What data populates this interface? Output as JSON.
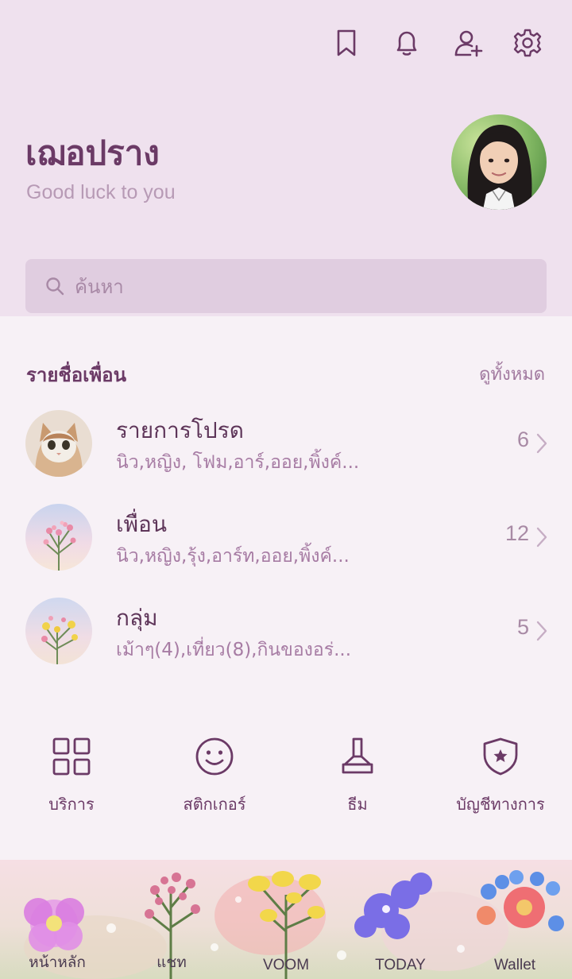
{
  "header": {
    "icons": [
      "bookmark-icon",
      "bell-icon",
      "add-friend-icon",
      "gear-icon"
    ]
  },
  "profile": {
    "name": "เฌอปราง",
    "status": "Good luck to you"
  },
  "search": {
    "placeholder": "ค้นหา"
  },
  "friends_section": {
    "title": "รายชื่อเพื่อน",
    "view_all": "ดูทั้งหมด",
    "rows": [
      {
        "title": "รายการโปรด",
        "subtitle": "นิว,หญิง, โฟม,อาร์,ออย,พิ้งค์...",
        "count": "6",
        "thumb": "cat-photo"
      },
      {
        "title": "เพื่อน",
        "subtitle": "นิว,หญิง,รุ้ง,อาร์ท,ออย,พิ้งค์...",
        "count": "12",
        "thumb": "pink-flower-photo"
      },
      {
        "title": "กลุ่ม",
        "subtitle": "เม้าๆ(4),เที่ยว(8),กินของอร่...",
        "count": "5",
        "thumb": "yellow-flower-photo"
      }
    ]
  },
  "services": [
    {
      "label": "บริการ",
      "icon": "grid-icon"
    },
    {
      "label": "สติกเกอร์",
      "icon": "smiley-icon"
    },
    {
      "label": "ธีม",
      "icon": "brush-icon"
    },
    {
      "label": "บัญชีทางการ",
      "icon": "shield-star-icon"
    }
  ],
  "tabs": [
    {
      "label": "หน้าหลัก"
    },
    {
      "label": "แชท"
    },
    {
      "label": "VOOM"
    },
    {
      "label": "TODAY"
    },
    {
      "label": "Wallet"
    }
  ],
  "colors": {
    "accent": "#6b3a66",
    "header_bg": "#efe1ee",
    "body_bg": "#f7f1f6",
    "search_bg": "#e0cde0"
  }
}
